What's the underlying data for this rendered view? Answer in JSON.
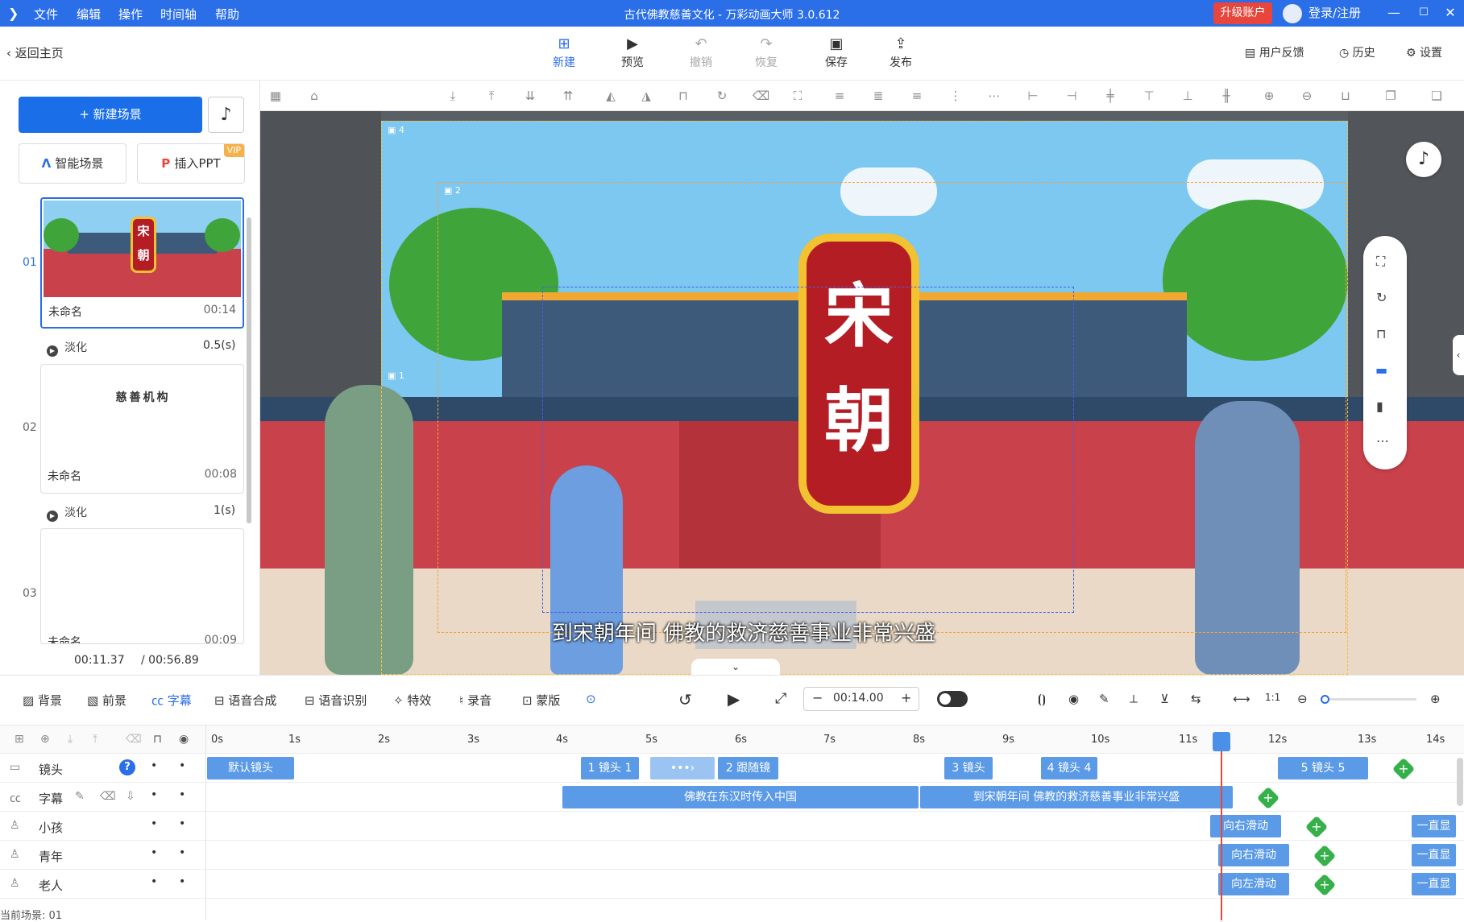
{
  "window": {
    "title": "古代佛教慈善文化 - 万彩动画大师 3.0.612",
    "menus": [
      "文件",
      "编辑",
      "操作",
      "时间轴",
      "帮助"
    ],
    "upgrade_label": "升级账户",
    "login_label": "登录/注册"
  },
  "toolbar": {
    "back_label": "返回主页",
    "new_label": "新建",
    "preview_label": "预览",
    "undo_label": "撤销",
    "redo_label": "恢复",
    "save_label": "保存",
    "publish_label": "发布",
    "feedback_label": "用户反馈",
    "history_label": "历史",
    "settings_label": "设置"
  },
  "left": {
    "new_scene_label": "新建场景",
    "smart_scene_label": "智能场景",
    "insert_ppt_label": "插入PPT",
    "vip_label": "VIP",
    "scenes": [
      {
        "num": "01",
        "name": "未命名",
        "duration": "00:14"
      },
      {
        "num": "02",
        "name": "未命名",
        "duration": "00:08",
        "preview_text": "慈善机构"
      },
      {
        "num": "03",
        "name": "未命名",
        "duration": "00:09"
      }
    ],
    "transitions": [
      {
        "name": "淡化",
        "duration": "0.5(s)"
      },
      {
        "name": "淡化",
        "duration": "1(s)"
      }
    ],
    "time_current": "00:11.37",
    "time_total": "/ 00:56.89"
  },
  "stage": {
    "sign_chars": [
      "宋",
      "朝"
    ],
    "subtitle": "到宋朝年间 佛教的救济慈善事业非常兴盛",
    "camera_labels": [
      "1",
      "2",
      "4"
    ],
    "colors": {
      "sky": "#7cc8f0",
      "wall": "#c9414a",
      "roof": "#3d5a7a",
      "sign_red": "#b51d25",
      "sign_gold": "#f2c230"
    }
  },
  "bottom": {
    "tabs": [
      "背景",
      "前景",
      "字幕",
      "语音合成",
      "语音识别",
      "特效",
      "录音",
      "蒙版"
    ],
    "active_tab": "字幕",
    "time_value": "00:14.00"
  },
  "timeline": {
    "ticks": [
      "0s",
      "1s",
      "2s",
      "3s",
      "4s",
      "5s",
      "6s",
      "7s",
      "8s",
      "9s",
      "10s",
      "11s",
      "12s",
      "13s",
      "14s"
    ],
    "tracks": [
      {
        "name": "镜头",
        "clips": [
          "默认镜头",
          "1 镜头 1",
          "2 跟随镜",
          "3 镜头",
          "4 镜头 4",
          "5 镜头 5"
        ]
      },
      {
        "name": "字幕",
        "clips": [
          "佛教在东汉时传入中国",
          "到宋朝年间 佛教的救济慈善事业非常兴盛"
        ]
      },
      {
        "name": "小孩",
        "clips": [
          "向右滑动",
          "一直显"
        ]
      },
      {
        "name": "青年",
        "clips": [
          "向右滑动",
          "一直显"
        ]
      },
      {
        "name": "老人",
        "clips": [
          "向左滑动",
          "一直显"
        ]
      }
    ],
    "current_scene_label": "当前场景: 01"
  }
}
